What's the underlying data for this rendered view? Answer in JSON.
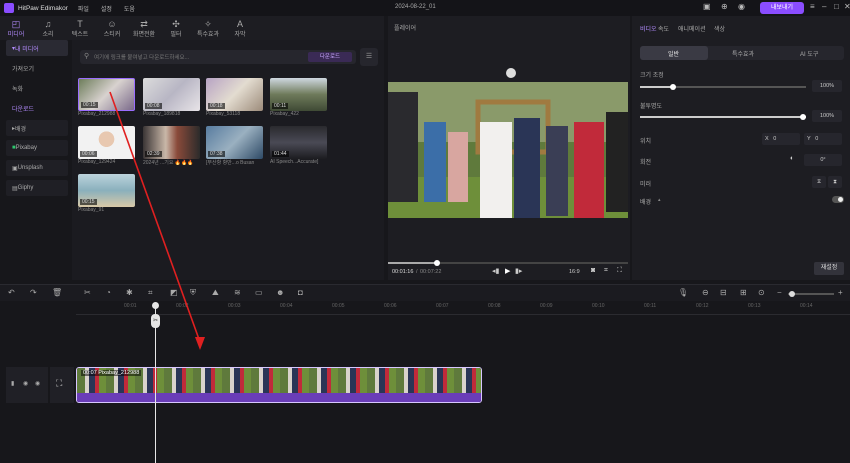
{
  "app": {
    "name": "HitPaw Edimakor",
    "menus": [
      "파일",
      "설정",
      "도움"
    ],
    "document_title": "2024-08-22_01",
    "export_label": "내보내기"
  },
  "toolbar": {
    "tabs": [
      {
        "label": "미디어",
        "icon": "media-icon"
      },
      {
        "label": "소리",
        "icon": "music-icon"
      },
      {
        "label": "텍스트",
        "icon": "text-icon"
      },
      {
        "label": "스티커",
        "icon": "sticker-icon"
      },
      {
        "label": "화면전환",
        "icon": "transition-icon"
      },
      {
        "label": "필터",
        "icon": "filter-icon"
      },
      {
        "label": "특수효과",
        "icon": "effects-icon"
      },
      {
        "label": "자막",
        "icon": "subtitle-icon"
      }
    ]
  },
  "sidebar": {
    "my_media": "내 미디어",
    "import": "가져오기",
    "recording": "녹화",
    "downloads": "다운로드",
    "background": "배경",
    "pixabay": "Pixabay",
    "unsplash": "Unsplash",
    "giphy": "Giphy"
  },
  "media_panel": {
    "search_placeholder": "여기에 링크를 붙여넣고 다운로드하세요...",
    "download_label": "다운로드",
    "items": [
      {
        "duration": "00:15",
        "name": "Pixabay_212988"
      },
      {
        "duration": "00:08",
        "name": "Pixabay_189818"
      },
      {
        "duration": "00:18",
        "name": "Pixabay_53118"
      },
      {
        "duration": "00:11",
        "name": "Pixabay_422"
      },
      {
        "duration": "00:06",
        "name": "Pixabay_129424"
      },
      {
        "duration": "02:39",
        "name": "2024년 ...기요 🔥🔥🔥"
      },
      {
        "duration": "07:38",
        "name": "[부산항 항만...o Busan"
      },
      {
        "duration": "01:44",
        "name": "AI Speech...Accurate]"
      },
      {
        "duration": "00:15",
        "name": "Pixabay_91"
      }
    ]
  },
  "player": {
    "title": "플레이어",
    "time_current": "00:01:16",
    "time_total": "00:07:22",
    "progress": 0.2,
    "aspect": "16:9"
  },
  "properties": {
    "tabs": [
      "비디오",
      "속도",
      "애니메이션",
      "색상"
    ],
    "segments": [
      "일반",
      "특수효과",
      "AI 도구"
    ],
    "scale_label": "크기 조정",
    "scale_value": "100%",
    "opacity_label": "불투명도",
    "opacity_value": "100%",
    "position_label": "위치",
    "pos_x_label": "X",
    "pos_x": "0",
    "pos_y_label": "Y",
    "pos_y": "0",
    "rotation_label": "회전",
    "rotation_value": "0°",
    "mirror_label": "미러",
    "background_label": "배경",
    "reset_label": "재설정"
  },
  "timeline": {
    "ticks": [
      "00:01",
      "00:02",
      "00:03",
      "00:04",
      "00:05",
      "00:06",
      "00:07",
      "00:08",
      "00:09",
      "00:10",
      "00:11",
      "00:12",
      "00:13",
      "00:14"
    ],
    "clip_label": "00:07 Pixabay_212988"
  }
}
